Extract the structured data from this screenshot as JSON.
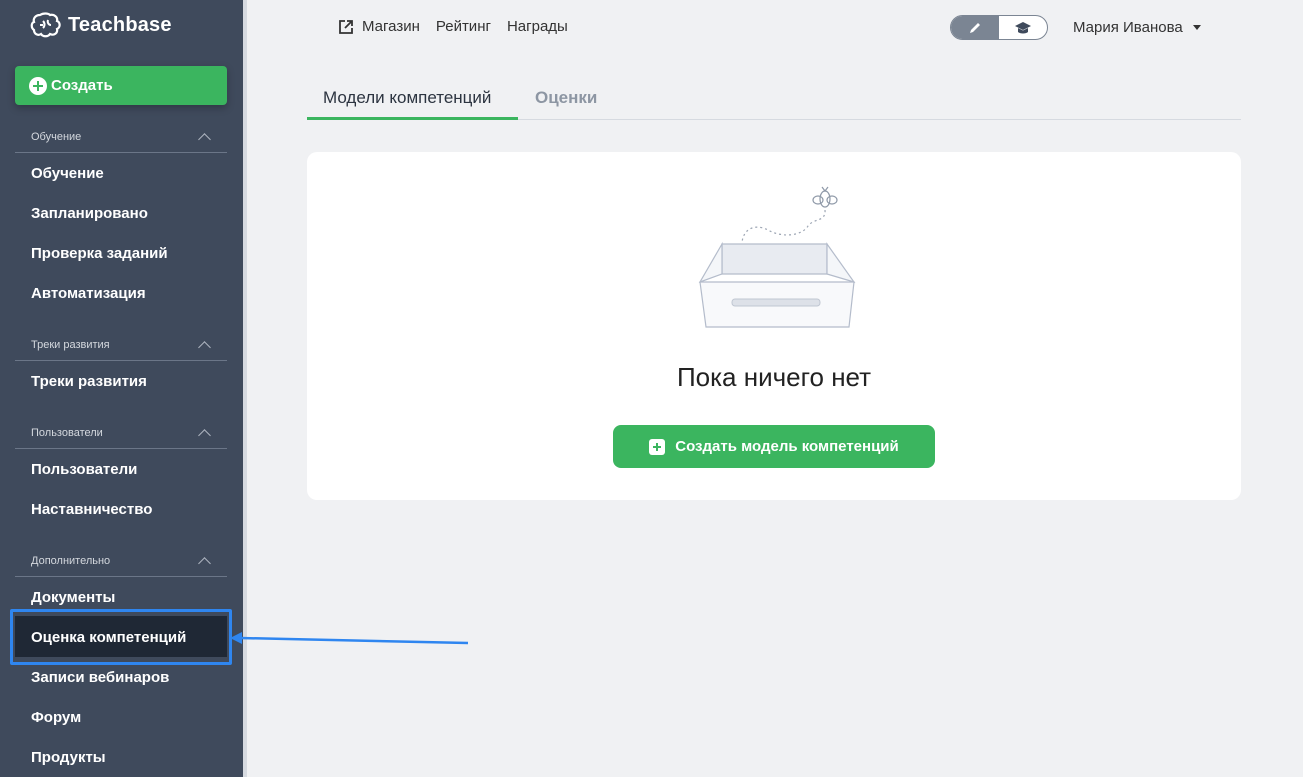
{
  "sidebar": {
    "brand": "Teachbase",
    "create_label": "Создать",
    "sections": [
      {
        "title": "Обучение",
        "items": [
          "Обучение",
          "Запланировано",
          "Проверка заданий",
          "Автоматизация"
        ]
      },
      {
        "title": "Треки развития",
        "items": [
          "Треки развития"
        ]
      },
      {
        "title": "Пользователи",
        "items": [
          "Пользователи",
          "Наставничество"
        ]
      },
      {
        "title": "Дополнительно",
        "items": [
          "Документы",
          "Оценка компетенций",
          "Записи вебинаров",
          "Форум",
          "Продукты"
        ]
      }
    ],
    "active_item": "Оценка компетенций"
  },
  "topnav": {
    "links": [
      "Магазин",
      "Рейтинг",
      "Награды"
    ]
  },
  "user": {
    "name": "Мария Иванова"
  },
  "tabs": [
    {
      "label": "Модели компетенций",
      "active": true
    },
    {
      "label": "Оценки",
      "active": false
    }
  ],
  "empty_state": {
    "title": "Пока ничего нет",
    "button_label": "Создать модель компетенций"
  },
  "colors": {
    "sidebar_bg": "#3f4a5c",
    "accent_green": "#3bb55f",
    "highlight_blue": "#2f86f0"
  }
}
